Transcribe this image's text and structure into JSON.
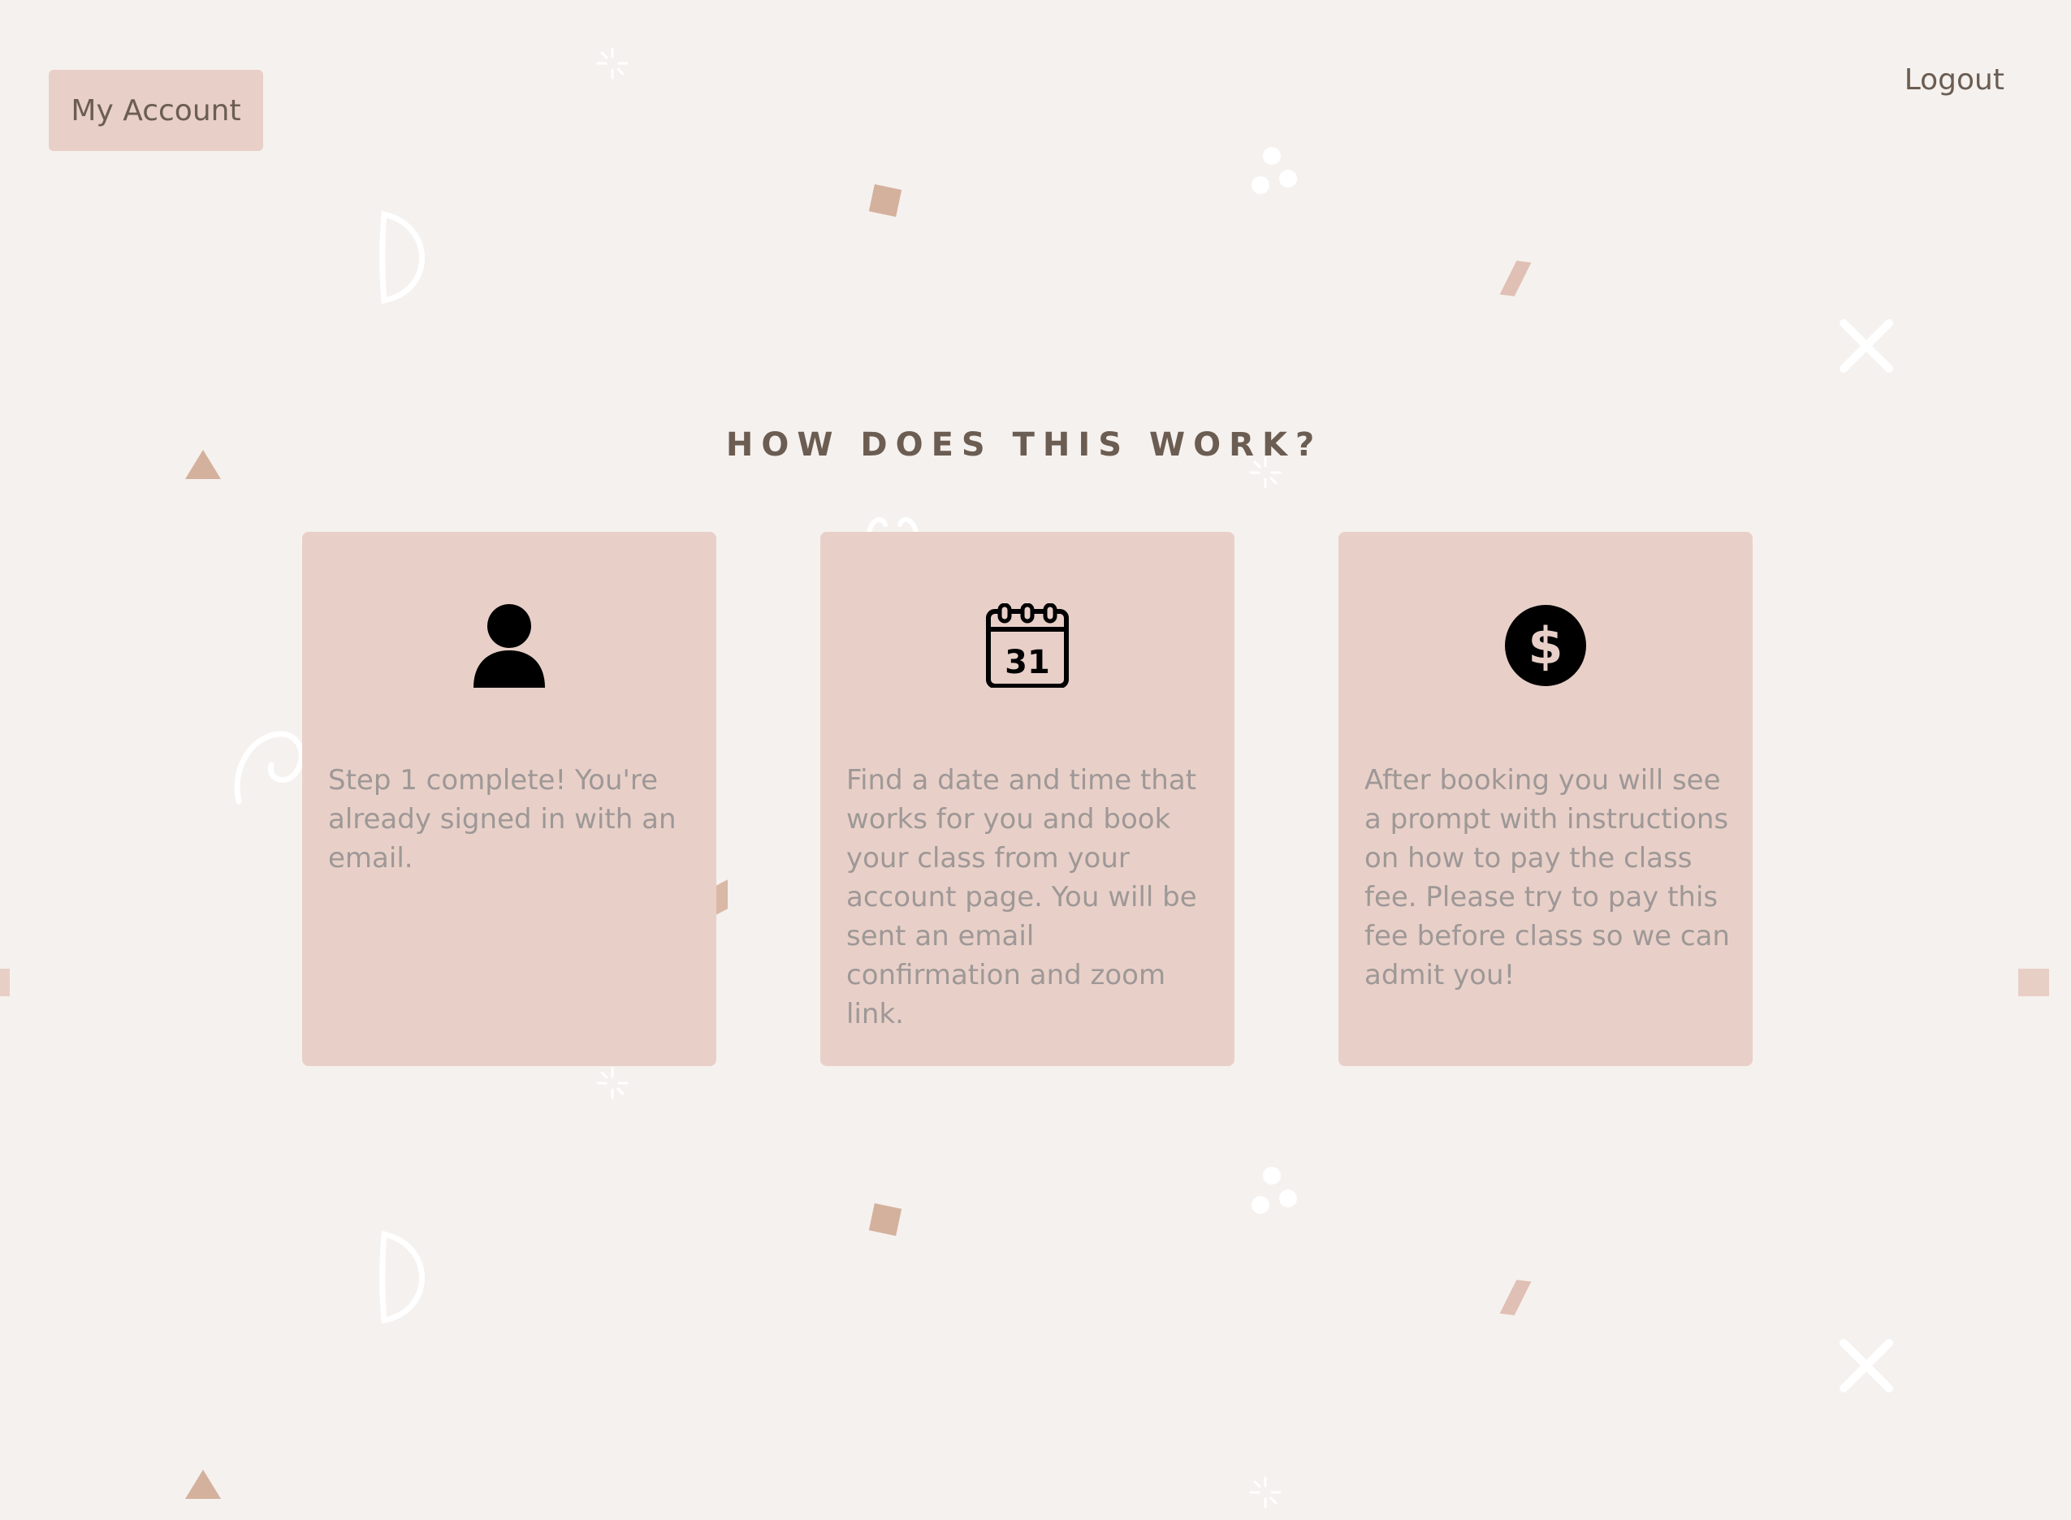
{
  "header": {
    "account_label": "My Account",
    "logout_label": "Logout"
  },
  "section": {
    "title": "HOW DOES THIS WORK?"
  },
  "steps": [
    {
      "icon": "user-icon",
      "text": "Step 1 complete! You're already signed in with an email."
    },
    {
      "icon": "calendar-icon",
      "text": "Find a date and time that works for you and book your class from your account page. You will be sent an email confirmation and zoom link."
    },
    {
      "icon": "dollar-icon",
      "text": "After booking you will see a prompt with instructions on how to pay the class fee. Please try to pay this fee before class so we can admit you!"
    }
  ],
  "calendar_day": "31",
  "colors": {
    "background": "#f5f1ee",
    "card": "#e8d0c8",
    "button": "#e8cfc7",
    "title_text": "#6b5d52",
    "body_text": "#9e9897",
    "accent_shape": "#d4b19d"
  }
}
